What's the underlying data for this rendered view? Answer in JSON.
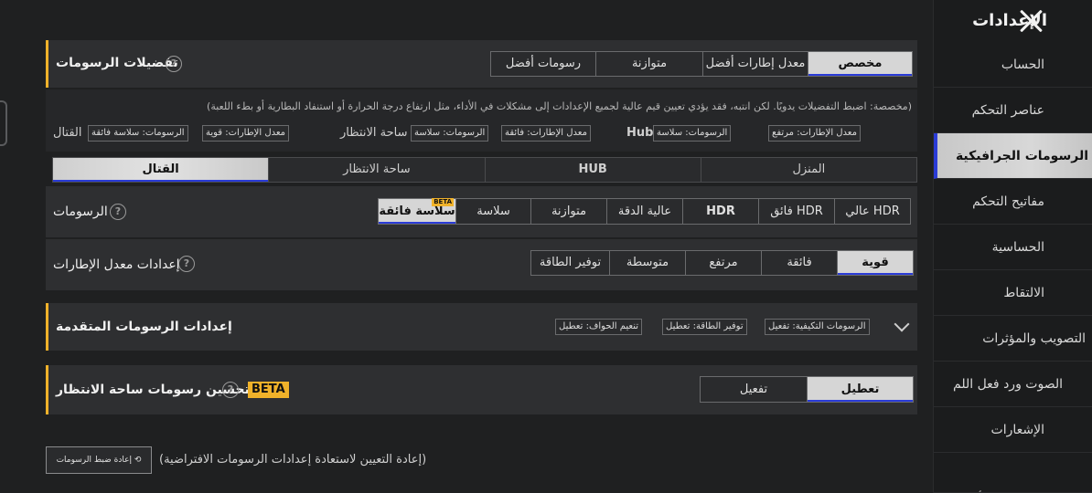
{
  "sidebar": {
    "title": "الإعدادات",
    "items": [
      {
        "label": "الحساب"
      },
      {
        "label": "عناصر التحكم"
      },
      {
        "label": "الرسومات الجرافيكية"
      },
      {
        "label": "مفاتيح التحكم"
      },
      {
        "label": "الحساسية"
      },
      {
        "label": "الالتقاط"
      },
      {
        "label": "التصويب والمؤثرات"
      },
      {
        "label": "الصوت ورد فعل اللم"
      },
      {
        "label": "الإشعارات"
      },
      {
        "label": "الإعدادات الأخرى"
      }
    ]
  },
  "graphics_prefs": {
    "title": "تفضيلات الرسومات",
    "options": [
      "مخصص",
      "معدل إطارات أفضل",
      "متوازنة",
      "رسومات أفضل"
    ],
    "selected": "مخصص",
    "description": "(مخصصة: اضبط التفضيلات يدويًا. لكن انتبه، فقد يؤدي تعيين قيم عالية لجميع الإعدادات إلى مشكلات في الأداء، مثل ارتفاع درجة الحرارة أو استنفاد البطارية أو بطء اللعبة)",
    "modes": [
      {
        "name": "Hub",
        "fps": "معدل الإطارات: مرتفع",
        "gfx": "الرسومات: سلاسة"
      },
      {
        "name": "ساحة الانتظار",
        "fps": "معدل الإطارات: فائقة",
        "gfx": "الرسومات: سلاسة"
      },
      {
        "name": "القتال",
        "fps": "معدل الإطارات: قوية",
        "gfx": "الرسومات: سلاسة فائقة"
      }
    ]
  },
  "mode_tabs": [
    "المنزل",
    "HUB",
    "ساحة الانتظار",
    "القتال"
  ],
  "mode_tab_selected": "القتال",
  "graphics": {
    "label": "الرسومات",
    "options": [
      "عالي HDR",
      "فائق HDR",
      "HDR",
      "عالية الدقة",
      "متوازنة",
      "سلاسة",
      "سلاسة فائقة"
    ],
    "selected": "سلاسة فائقة",
    "beta_tag": "BETA"
  },
  "fps": {
    "label": "إعدادات معدل الإطارات",
    "options": [
      "قوية",
      "فائقة",
      "مرتفع",
      "متوسطة",
      "توفير الطاقة"
    ],
    "selected": "قوية"
  },
  "advanced": {
    "title": "إعدادات الرسومات المتقدمة",
    "tags": [
      "الرسومات التكيفية: تفعيل",
      "توفير الطاقة: تعطيل",
      "تنعيم الحواف: تعطيل"
    ]
  },
  "lobby_enhance": {
    "title": "تحسين رسومات ساحة الانتظار",
    "beta": "BETA",
    "options": [
      "تعطيل",
      "تفعيل"
    ],
    "selected": "تعطيل"
  },
  "reset": {
    "button": "إعادة ضبط الرسومات",
    "description": "(إعادة التعيين لاستعادة إعدادات الرسومات الافتراضية)"
  },
  "colors": {
    "accent": "#f0b22a",
    "selected_bg": "#d6d6d6",
    "underline": "#2a3bd6"
  }
}
